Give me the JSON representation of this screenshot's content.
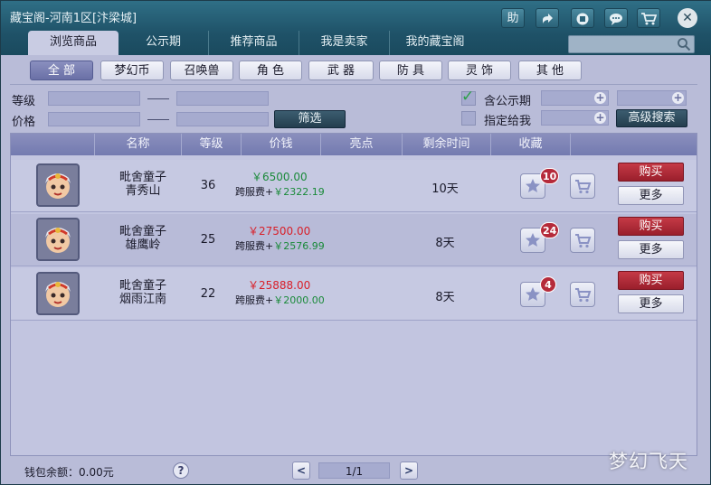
{
  "window": {
    "title": "藏宝阁-河南1区[汴梁城]",
    "toolbar": {
      "help_label": "助",
      "share_icon": "share-arrow-icon",
      "record_icon": "record-stop-icon",
      "chat_icon": "chat-bubble-icon",
      "cart_icon": "shopping-cart-icon",
      "close_label": "✕"
    }
  },
  "tabs": [
    {
      "label": "浏览商品",
      "active": true
    },
    {
      "label": "公示期",
      "active": false
    },
    {
      "label": "推荐商品",
      "active": false
    },
    {
      "label": "我是卖家",
      "active": false
    },
    {
      "label": "我的藏宝阁",
      "active": false
    }
  ],
  "search": {
    "placeholder": ""
  },
  "categories": [
    {
      "label": "全 部",
      "active": true
    },
    {
      "label": "梦幻币",
      "active": false
    },
    {
      "label": "召唤兽",
      "active": false
    },
    {
      "label": "角 色",
      "active": false
    },
    {
      "label": "武 器",
      "active": false
    },
    {
      "label": "防 具",
      "active": false
    },
    {
      "label": "灵 饰",
      "active": false
    },
    {
      "label": "其 他",
      "active": false
    }
  ],
  "filters": {
    "level_label": "等级",
    "price_label": "价格",
    "filter_button": "筛选",
    "include_public_label": "含公示期",
    "include_public_checked": true,
    "assign_to_me_label": "指定给我",
    "assign_to_me_checked": false,
    "advanced_search_button": "高级搜索"
  },
  "table": {
    "headers": [
      "名称",
      "等级",
      "价钱",
      "亮点",
      "剩余时间",
      "收藏"
    ],
    "rows": [
      {
        "name_line1": "毗舍童子",
        "name_line2": "青秀山",
        "level": "36",
        "price": "￥6500.00",
        "price_color": "#1a8a3a",
        "fee_label": "跨服费+",
        "fee": "￥2322.19",
        "time_left": "10天",
        "fav_count": "10",
        "buy_label": "购买",
        "more_label": "更多"
      },
      {
        "name_line1": "毗舍童子",
        "name_line2": "雄鹰岭",
        "level": "25",
        "price": "￥27500.00",
        "price_color": "#d8202a",
        "fee_label": "跨服费+",
        "fee": "￥2576.99",
        "time_left": "8天",
        "fav_count": "24",
        "buy_label": "购买",
        "more_label": "更多"
      },
      {
        "name_line1": "毗舍童子",
        "name_line2": "烟雨江南",
        "level": "22",
        "price": "￥25888.00",
        "price_color": "#d8202a",
        "fee_label": "跨服费+",
        "fee": "￥2000.00",
        "time_left": "8天",
        "fav_count": "4",
        "buy_label": "购买",
        "more_label": "更多"
      }
    ]
  },
  "footer": {
    "wallet_label": "钱包余额：0.00元",
    "help_label": "?",
    "prev_label": "<",
    "page_text": "1/1",
    "next_label": ">"
  },
  "watermark": "梦幻飞天",
  "colors": {
    "title_bar": "#1f5268",
    "panel": "#b9bcd8",
    "header": "#7b81b4",
    "buy_red": "#b02a36",
    "price_green": "#1a8a3a",
    "price_red": "#d8202a"
  }
}
